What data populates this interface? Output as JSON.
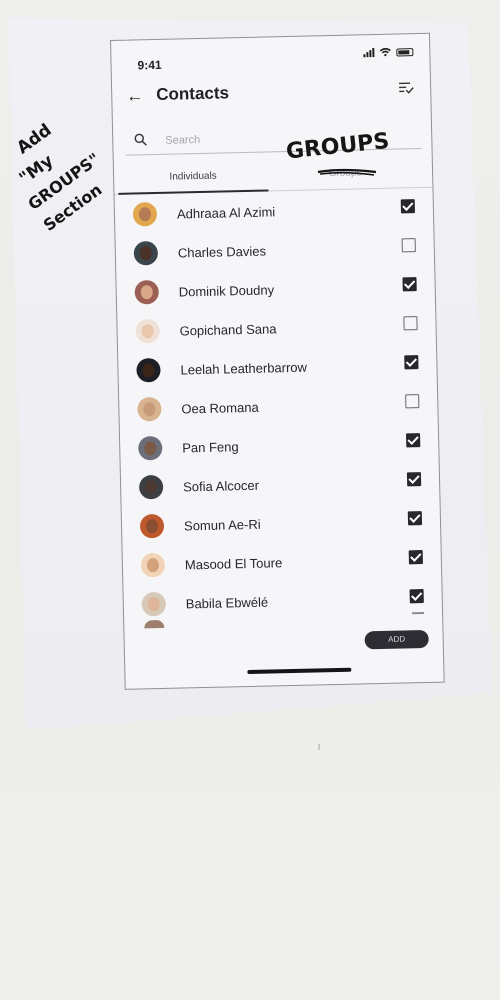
{
  "status_bar": {
    "time": "9:41"
  },
  "appbar": {
    "title": "Contacts"
  },
  "search": {
    "placeholder": "Search"
  },
  "tabs": [
    {
      "label": "Individuals",
      "active": true
    },
    {
      "label": "Groups",
      "active": false
    }
  ],
  "contacts": [
    {
      "name": "Adhraaa Al Azimi",
      "checked": true
    },
    {
      "name": "Charles Davies",
      "checked": false
    },
    {
      "name": "Dominik Doudny",
      "checked": true
    },
    {
      "name": "Gopichand Sana",
      "checked": false
    },
    {
      "name": "Leelah Leatherbarrow",
      "checked": true
    },
    {
      "name": "Oea Romana",
      "checked": false
    },
    {
      "name": "Pan Feng",
      "checked": true
    },
    {
      "name": "Sofia Alcocer",
      "checked": true
    },
    {
      "name": "Somun Ae-Ri",
      "checked": true
    },
    {
      "name": "Masood El Toure",
      "checked": true
    },
    {
      "name": "Babila Ebwélé",
      "checked": true
    }
  ],
  "actions": {
    "add_label": "ADD"
  },
  "annotations": {
    "note_lines": [
      "Add",
      "\"My",
      "GROUPS\"",
      "Section"
    ],
    "groups_label": "GROUPS"
  },
  "colors": {
    "accent": "#2b2b33",
    "checkbox_checked": "#27272d",
    "ink": "#151515"
  }
}
